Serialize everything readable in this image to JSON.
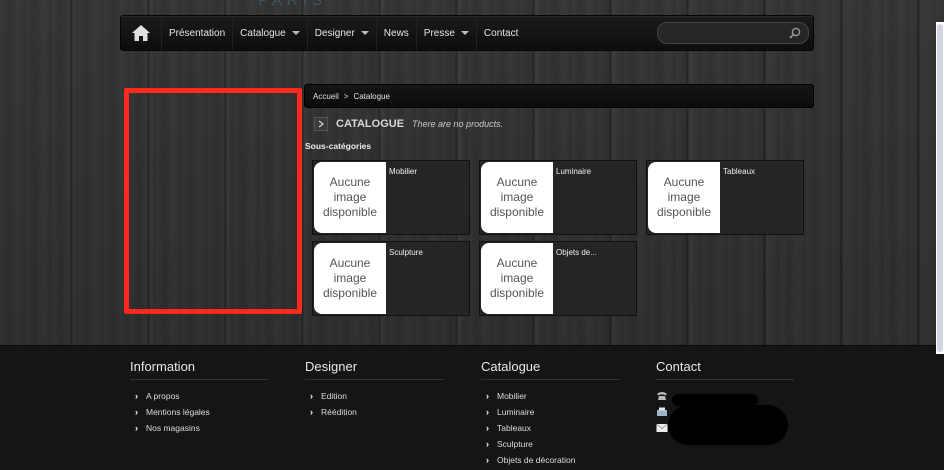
{
  "header": {
    "logo_text": "PARIS"
  },
  "nav": {
    "items": [
      {
        "label": "Présentation",
        "dropdown": false
      },
      {
        "label": "Catalogue",
        "dropdown": true
      },
      {
        "label": "Designer",
        "dropdown": true
      },
      {
        "label": "News",
        "dropdown": false
      },
      {
        "label": "Presse",
        "dropdown": true
      },
      {
        "label": "Contact",
        "dropdown": false
      }
    ],
    "search_value": ""
  },
  "breadcrumb": {
    "home": "Accueil",
    "separator": ">",
    "current": "Catalogue"
  },
  "category": {
    "title": "CATALOGUE",
    "subtitle": "There are no products."
  },
  "subcategories": {
    "heading": "Sous-catégories",
    "placeholder_text": [
      "Aucune",
      "image",
      "disponible"
    ],
    "items": [
      "Mobilier",
      "Luminaire",
      "Tableaux",
      "Sculpture",
      "Objets de..."
    ]
  },
  "footer": {
    "information": {
      "title": "Information",
      "links": [
        "A propos",
        "Mentions légales",
        "Nos magasins"
      ]
    },
    "designer": {
      "title": "Designer",
      "links": [
        "Edition",
        "Réédition"
      ]
    },
    "catalogue": {
      "title": "Catalogue",
      "links": [
        "Mobilier",
        "Luminaire",
        "Tableaux",
        "Sculpture",
        "Objets de décoration"
      ]
    },
    "contact": {
      "title": "Contact"
    }
  },
  "colors": {
    "annotation_red": "#ff2a1d",
    "nav_bg": "#111111",
    "footer_bg": "#151515"
  }
}
